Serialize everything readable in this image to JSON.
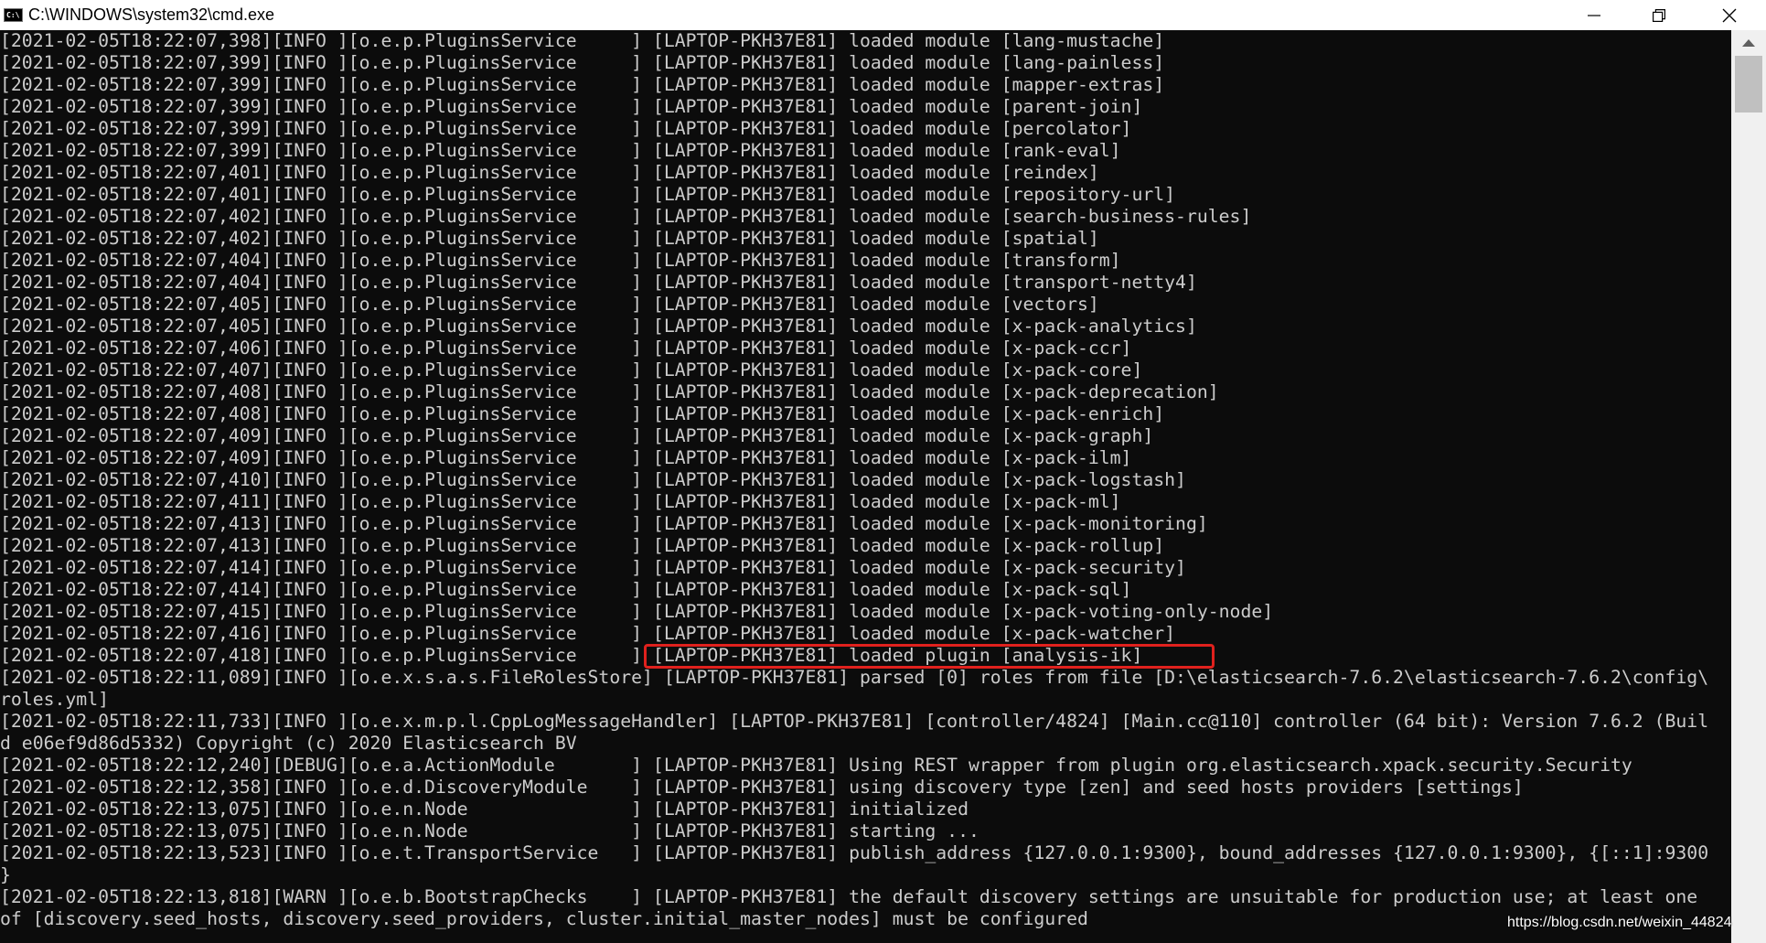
{
  "window": {
    "title": "C:\\WINDOWS\\system32\\cmd.exe",
    "icon_label": "C:\\"
  },
  "console": {
    "lines": [
      "[2021-02-05T18:22:07,398][INFO ][o.e.p.PluginsService     ] [LAPTOP-PKH37E81] loaded module [lang-mustache]",
      "[2021-02-05T18:22:07,399][INFO ][o.e.p.PluginsService     ] [LAPTOP-PKH37E81] loaded module [lang-painless]",
      "[2021-02-05T18:22:07,399][INFO ][o.e.p.PluginsService     ] [LAPTOP-PKH37E81] loaded module [mapper-extras]",
      "[2021-02-05T18:22:07,399][INFO ][o.e.p.PluginsService     ] [LAPTOP-PKH37E81] loaded module [parent-join]",
      "[2021-02-05T18:22:07,399][INFO ][o.e.p.PluginsService     ] [LAPTOP-PKH37E81] loaded module [percolator]",
      "[2021-02-05T18:22:07,399][INFO ][o.e.p.PluginsService     ] [LAPTOP-PKH37E81] loaded module [rank-eval]",
      "[2021-02-05T18:22:07,401][INFO ][o.e.p.PluginsService     ] [LAPTOP-PKH37E81] loaded module [reindex]",
      "[2021-02-05T18:22:07,401][INFO ][o.e.p.PluginsService     ] [LAPTOP-PKH37E81] loaded module [repository-url]",
      "[2021-02-05T18:22:07,402][INFO ][o.e.p.PluginsService     ] [LAPTOP-PKH37E81] loaded module [search-business-rules]",
      "[2021-02-05T18:22:07,402][INFO ][o.e.p.PluginsService     ] [LAPTOP-PKH37E81] loaded module [spatial]",
      "[2021-02-05T18:22:07,404][INFO ][o.e.p.PluginsService     ] [LAPTOP-PKH37E81] loaded module [transform]",
      "[2021-02-05T18:22:07,404][INFO ][o.e.p.PluginsService     ] [LAPTOP-PKH37E81] loaded module [transport-netty4]",
      "[2021-02-05T18:22:07,405][INFO ][o.e.p.PluginsService     ] [LAPTOP-PKH37E81] loaded module [vectors]",
      "[2021-02-05T18:22:07,405][INFO ][o.e.p.PluginsService     ] [LAPTOP-PKH37E81] loaded module [x-pack-analytics]",
      "[2021-02-05T18:22:07,406][INFO ][o.e.p.PluginsService     ] [LAPTOP-PKH37E81] loaded module [x-pack-ccr]",
      "[2021-02-05T18:22:07,407][INFO ][o.e.p.PluginsService     ] [LAPTOP-PKH37E81] loaded module [x-pack-core]",
      "[2021-02-05T18:22:07,408][INFO ][o.e.p.PluginsService     ] [LAPTOP-PKH37E81] loaded module [x-pack-deprecation]",
      "[2021-02-05T18:22:07,408][INFO ][o.e.p.PluginsService     ] [LAPTOP-PKH37E81] loaded module [x-pack-enrich]",
      "[2021-02-05T18:22:07,409][INFO ][o.e.p.PluginsService     ] [LAPTOP-PKH37E81] loaded module [x-pack-graph]",
      "[2021-02-05T18:22:07,409][INFO ][o.e.p.PluginsService     ] [LAPTOP-PKH37E81] loaded module [x-pack-ilm]",
      "[2021-02-05T18:22:07,410][INFO ][o.e.p.PluginsService     ] [LAPTOP-PKH37E81] loaded module [x-pack-logstash]",
      "[2021-02-05T18:22:07,411][INFO ][o.e.p.PluginsService     ] [LAPTOP-PKH37E81] loaded module [x-pack-ml]",
      "[2021-02-05T18:22:07,413][INFO ][o.e.p.PluginsService     ] [LAPTOP-PKH37E81] loaded module [x-pack-monitoring]",
      "[2021-02-05T18:22:07,413][INFO ][o.e.p.PluginsService     ] [LAPTOP-PKH37E81] loaded module [x-pack-rollup]",
      "[2021-02-05T18:22:07,414][INFO ][o.e.p.PluginsService     ] [LAPTOP-PKH37E81] loaded module [x-pack-security]",
      "[2021-02-05T18:22:07,414][INFO ][o.e.p.PluginsService     ] [LAPTOP-PKH37E81] loaded module [x-pack-sql]",
      "[2021-02-05T18:22:07,415][INFO ][o.e.p.PluginsService     ] [LAPTOP-PKH37E81] loaded module [x-pack-voting-only-node]",
      "[2021-02-05T18:22:07,416][INFO ][o.e.p.PluginsService     ] [LAPTOP-PKH37E81] loaded module [x-pack-watcher]",
      "[2021-02-05T18:22:07,418][INFO ][o.e.p.PluginsService     ] [LAPTOP-PKH37E81] loaded plugin [analysis-ik]",
      "[2021-02-05T18:22:11,089][INFO ][o.e.x.s.a.s.FileRolesStore] [LAPTOP-PKH37E81] parsed [0] roles from file [D:\\elasticsearch-7.6.2\\elasticsearch-7.6.2\\config\\",
      "roles.yml]",
      "[2021-02-05T18:22:11,733][INFO ][o.e.x.m.p.l.CppLogMessageHandler] [LAPTOP-PKH37E81] [controller/4824] [Main.cc@110] controller (64 bit): Version 7.6.2 (Buil",
      "d e06ef9d86d5332) Copyright (c) 2020 Elasticsearch BV",
      "[2021-02-05T18:22:12,240][DEBUG][o.e.a.ActionModule       ] [LAPTOP-PKH37E81] Using REST wrapper from plugin org.elasticsearch.xpack.security.Security",
      "[2021-02-05T18:22:12,358][INFO ][o.e.d.DiscoveryModule    ] [LAPTOP-PKH37E81] using discovery type [zen] and seed hosts providers [settings]",
      "[2021-02-05T18:22:13,075][INFO ][o.e.n.Node               ] [LAPTOP-PKH37E81] initialized",
      "[2021-02-05T18:22:13,075][INFO ][o.e.n.Node               ] [LAPTOP-PKH37E81] starting ...",
      "[2021-02-05T18:22:13,523][INFO ][o.e.t.TransportService   ] [LAPTOP-PKH37E81] publish_address {127.0.0.1:9300}, bound_addresses {127.0.0.1:9300}, {[::1]:9300",
      "}",
      "[2021-02-05T18:22:13,818][WARN ][o.e.b.BootstrapChecks    ] [LAPTOP-PKH37E81] the default discovery settings are unsuitable for production use; at least one",
      "of [discovery.seed_hosts, discovery.seed_providers, cluster.initial_master_nodes] must be configured"
    ]
  },
  "watermark": "https://blog.csdn.net/weixin_44824",
  "colors": {
    "console_bg": "#0c0c0c",
    "console_text": "#cccccc",
    "highlight": "#e0211d"
  }
}
